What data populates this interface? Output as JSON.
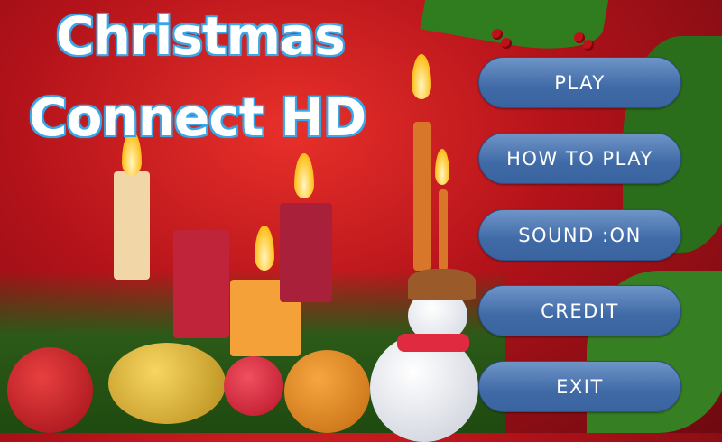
{
  "title": {
    "line1": "Christmas",
    "line2": "Connect HD"
  },
  "menu": {
    "play": "PLAY",
    "how_to_play": "HOW TO PLAY",
    "sound": "SOUND :ON",
    "credit": "CREDIT",
    "exit": "EXIT"
  },
  "colors": {
    "button": "#4a74ae",
    "title_outline": "#3aa8e8",
    "background": "#b3121a"
  }
}
